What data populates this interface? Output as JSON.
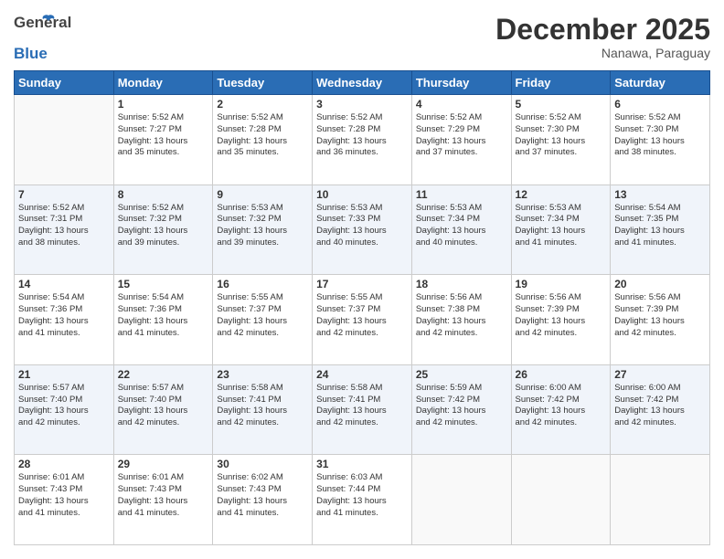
{
  "header": {
    "logo_general": "General",
    "logo_blue": "Blue",
    "month_title": "December 2025",
    "location": "Nanawa, Paraguay"
  },
  "days_of_week": [
    "Sunday",
    "Monday",
    "Tuesday",
    "Wednesday",
    "Thursday",
    "Friday",
    "Saturday"
  ],
  "weeks": [
    [
      {
        "day": "",
        "sunrise": "",
        "sunset": "",
        "daylight": ""
      },
      {
        "day": "1",
        "sunrise": "Sunrise: 5:52 AM",
        "sunset": "Sunset: 7:27 PM",
        "daylight": "Daylight: 13 hours and 35 minutes."
      },
      {
        "day": "2",
        "sunrise": "Sunrise: 5:52 AM",
        "sunset": "Sunset: 7:28 PM",
        "daylight": "Daylight: 13 hours and 35 minutes."
      },
      {
        "day": "3",
        "sunrise": "Sunrise: 5:52 AM",
        "sunset": "Sunset: 7:28 PM",
        "daylight": "Daylight: 13 hours and 36 minutes."
      },
      {
        "day": "4",
        "sunrise": "Sunrise: 5:52 AM",
        "sunset": "Sunset: 7:29 PM",
        "daylight": "Daylight: 13 hours and 37 minutes."
      },
      {
        "day": "5",
        "sunrise": "Sunrise: 5:52 AM",
        "sunset": "Sunset: 7:30 PM",
        "daylight": "Daylight: 13 hours and 37 minutes."
      },
      {
        "day": "6",
        "sunrise": "Sunrise: 5:52 AM",
        "sunset": "Sunset: 7:30 PM",
        "daylight": "Daylight: 13 hours and 38 minutes."
      }
    ],
    [
      {
        "day": "7",
        "sunrise": "Sunrise: 5:52 AM",
        "sunset": "Sunset: 7:31 PM",
        "daylight": "Daylight: 13 hours and 38 minutes."
      },
      {
        "day": "8",
        "sunrise": "Sunrise: 5:52 AM",
        "sunset": "Sunset: 7:32 PM",
        "daylight": "Daylight: 13 hours and 39 minutes."
      },
      {
        "day": "9",
        "sunrise": "Sunrise: 5:53 AM",
        "sunset": "Sunset: 7:32 PM",
        "daylight": "Daylight: 13 hours and 39 minutes."
      },
      {
        "day": "10",
        "sunrise": "Sunrise: 5:53 AM",
        "sunset": "Sunset: 7:33 PM",
        "daylight": "Daylight: 13 hours and 40 minutes."
      },
      {
        "day": "11",
        "sunrise": "Sunrise: 5:53 AM",
        "sunset": "Sunset: 7:34 PM",
        "daylight": "Daylight: 13 hours and 40 minutes."
      },
      {
        "day": "12",
        "sunrise": "Sunrise: 5:53 AM",
        "sunset": "Sunset: 7:34 PM",
        "daylight": "Daylight: 13 hours and 41 minutes."
      },
      {
        "day": "13",
        "sunrise": "Sunrise: 5:54 AM",
        "sunset": "Sunset: 7:35 PM",
        "daylight": "Daylight: 13 hours and 41 minutes."
      }
    ],
    [
      {
        "day": "14",
        "sunrise": "Sunrise: 5:54 AM",
        "sunset": "Sunset: 7:36 PM",
        "daylight": "Daylight: 13 hours and 41 minutes."
      },
      {
        "day": "15",
        "sunrise": "Sunrise: 5:54 AM",
        "sunset": "Sunset: 7:36 PM",
        "daylight": "Daylight: 13 hours and 41 minutes."
      },
      {
        "day": "16",
        "sunrise": "Sunrise: 5:55 AM",
        "sunset": "Sunset: 7:37 PM",
        "daylight": "Daylight: 13 hours and 42 minutes."
      },
      {
        "day": "17",
        "sunrise": "Sunrise: 5:55 AM",
        "sunset": "Sunset: 7:37 PM",
        "daylight": "Daylight: 13 hours and 42 minutes."
      },
      {
        "day": "18",
        "sunrise": "Sunrise: 5:56 AM",
        "sunset": "Sunset: 7:38 PM",
        "daylight": "Daylight: 13 hours and 42 minutes."
      },
      {
        "day": "19",
        "sunrise": "Sunrise: 5:56 AM",
        "sunset": "Sunset: 7:39 PM",
        "daylight": "Daylight: 13 hours and 42 minutes."
      },
      {
        "day": "20",
        "sunrise": "Sunrise: 5:56 AM",
        "sunset": "Sunset: 7:39 PM",
        "daylight": "Daylight: 13 hours and 42 minutes."
      }
    ],
    [
      {
        "day": "21",
        "sunrise": "Sunrise: 5:57 AM",
        "sunset": "Sunset: 7:40 PM",
        "daylight": "Daylight: 13 hours and 42 minutes."
      },
      {
        "day": "22",
        "sunrise": "Sunrise: 5:57 AM",
        "sunset": "Sunset: 7:40 PM",
        "daylight": "Daylight: 13 hours and 42 minutes."
      },
      {
        "day": "23",
        "sunrise": "Sunrise: 5:58 AM",
        "sunset": "Sunset: 7:41 PM",
        "daylight": "Daylight: 13 hours and 42 minutes."
      },
      {
        "day": "24",
        "sunrise": "Sunrise: 5:58 AM",
        "sunset": "Sunset: 7:41 PM",
        "daylight": "Daylight: 13 hours and 42 minutes."
      },
      {
        "day": "25",
        "sunrise": "Sunrise: 5:59 AM",
        "sunset": "Sunset: 7:42 PM",
        "daylight": "Daylight: 13 hours and 42 minutes."
      },
      {
        "day": "26",
        "sunrise": "Sunrise: 6:00 AM",
        "sunset": "Sunset: 7:42 PM",
        "daylight": "Daylight: 13 hours and 42 minutes."
      },
      {
        "day": "27",
        "sunrise": "Sunrise: 6:00 AM",
        "sunset": "Sunset: 7:42 PM",
        "daylight": "Daylight: 13 hours and 42 minutes."
      }
    ],
    [
      {
        "day": "28",
        "sunrise": "Sunrise: 6:01 AM",
        "sunset": "Sunset: 7:43 PM",
        "daylight": "Daylight: 13 hours and 41 minutes."
      },
      {
        "day": "29",
        "sunrise": "Sunrise: 6:01 AM",
        "sunset": "Sunset: 7:43 PM",
        "daylight": "Daylight: 13 hours and 41 minutes."
      },
      {
        "day": "30",
        "sunrise": "Sunrise: 6:02 AM",
        "sunset": "Sunset: 7:43 PM",
        "daylight": "Daylight: 13 hours and 41 minutes."
      },
      {
        "day": "31",
        "sunrise": "Sunrise: 6:03 AM",
        "sunset": "Sunset: 7:44 PM",
        "daylight": "Daylight: 13 hours and 41 minutes."
      },
      {
        "day": "",
        "sunrise": "",
        "sunset": "",
        "daylight": ""
      },
      {
        "day": "",
        "sunrise": "",
        "sunset": "",
        "daylight": ""
      },
      {
        "day": "",
        "sunrise": "",
        "sunset": "",
        "daylight": ""
      }
    ]
  ]
}
